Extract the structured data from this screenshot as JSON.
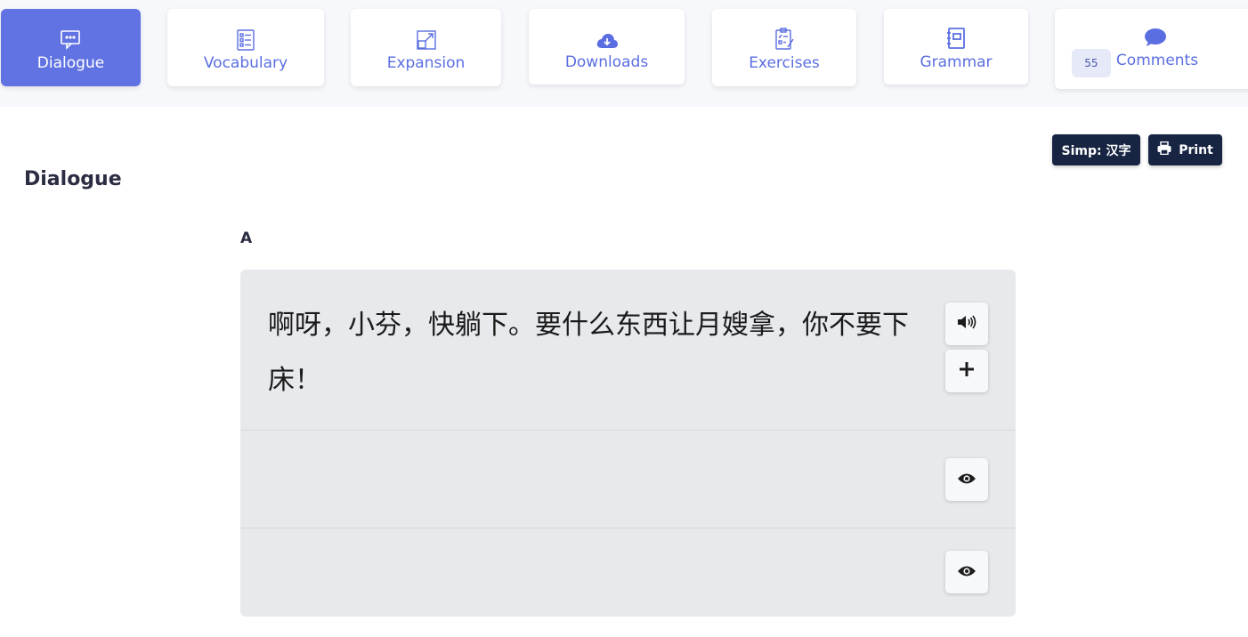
{
  "tabs": [
    {
      "label": "Dialogue",
      "icon": "chat-bubble-icon",
      "active": true
    },
    {
      "label": "Vocabulary",
      "icon": "list-icon",
      "active": false
    },
    {
      "label": "Expansion",
      "icon": "expand-icon",
      "active": false
    },
    {
      "label": "Downloads",
      "icon": "cloud-download-icon",
      "active": false
    },
    {
      "label": "Exercises",
      "icon": "clipboard-icon",
      "active": false
    },
    {
      "label": "Grammar",
      "icon": "notebook-icon",
      "active": false
    },
    {
      "label": "Comments",
      "icon": "speech-bubble-icon",
      "active": false,
      "badge": "55"
    }
  ],
  "page": {
    "heading": "Dialogue",
    "simp_button": "Simp: 汉字",
    "print_button": "Print"
  },
  "dialogue": {
    "speaker": "A",
    "line": "啊呀，小芬，快躺下。要什么东西让月嫂拿，你不要下床！"
  },
  "colors": {
    "accent": "#6173e2",
    "dark_button": "#172442",
    "card_bg": "#e7e9ec"
  }
}
